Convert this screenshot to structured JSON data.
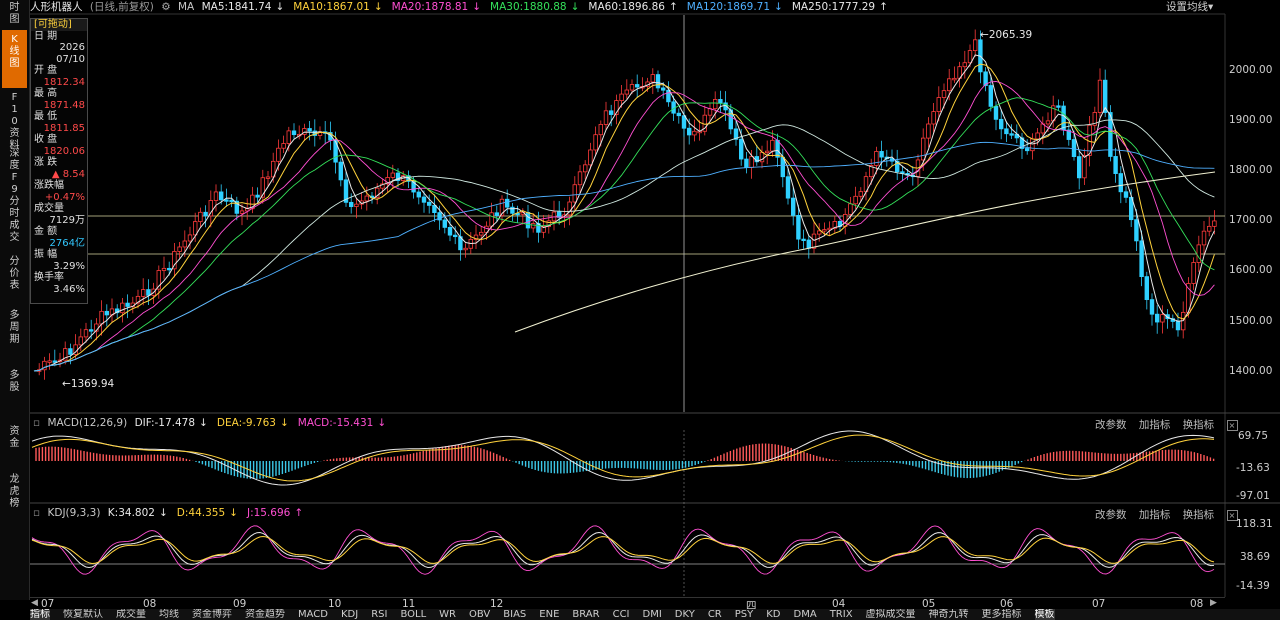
{
  "header": {
    "stock_name": "人形机器人",
    "adjust_note": "(日线,前复权)",
    "ma_label": "MA",
    "ma_items": [
      {
        "text": "MA5:1841.74",
        "arrow": "↓",
        "color": "#e8e8e8"
      },
      {
        "text": "MA10:1867.01",
        "arrow": "↓",
        "color": "#ffd23c"
      },
      {
        "text": "MA20:1878.81",
        "arrow": "↓",
        "color": "#ff4fd2"
      },
      {
        "text": "MA30:1880.88",
        "arrow": "↓",
        "color": "#34e05a"
      },
      {
        "text": "MA60:1896.86",
        "arrow": "↑",
        "color": "#e8e8e8"
      },
      {
        "text": "MA120:1869.71",
        "arrow": "↓",
        "color": "#4fb0ff"
      },
      {
        "text": "MA250:1777.29",
        "arrow": "↑",
        "color": "#e8e8e8"
      }
    ],
    "settings_label": "设置均线",
    "settings_arrow": "▾"
  },
  "left_nav": [
    {
      "label": "时图",
      "active": false
    },
    {
      "label": "K线图",
      "active": true
    },
    {
      "label": "F10资料",
      "active": false
    },
    {
      "label": "深度F9",
      "active": false
    },
    {
      "label": "分时成交",
      "active": false
    },
    {
      "label": "分价表",
      "active": false
    },
    {
      "label": "多周期",
      "active": false
    },
    {
      "label": "多股",
      "active": false
    },
    {
      "label": "资金",
      "active": false
    },
    {
      "label": "龙虎榜",
      "active": false
    }
  ],
  "info_panel": {
    "drag_label": "[可拖动]",
    "rows": [
      {
        "label": "日 期",
        "value": "2026",
        "color": "#e0e0e0"
      },
      {
        "label": "",
        "value": "07/10",
        "color": "#e0e0e0"
      },
      {
        "label": "开 盘",
        "value": "1812.34",
        "color": "#ff4a4a"
      },
      {
        "label": "最 高",
        "value": "1871.48",
        "color": "#ff4a4a"
      },
      {
        "label": "最 低",
        "value": "1811.85",
        "color": "#ff4a4a"
      },
      {
        "label": "收 盘",
        "value": "1820.06",
        "color": "#ff4a4a"
      },
      {
        "label": "涨 跌",
        "value": "▲ 8.54",
        "color": "#ff4a4a"
      },
      {
        "label": "涨跌幅",
        "value": "+0.47%",
        "color": "#ff4a4a"
      },
      {
        "label": "成交量",
        "value": "7129万",
        "color": "#e0e0e0"
      },
      {
        "label": "金 额",
        "value": "2764亿",
        "color": "#32c8ff"
      },
      {
        "label": "振 幅",
        "value": "3.29%",
        "color": "#e0e0e0"
      },
      {
        "label": "换手率",
        "value": "3.46%",
        "color": "#e0e0e0"
      }
    ]
  },
  "price_axis": [
    "2000.00",
    "1900.00",
    "1800.00",
    "1700.00",
    "1600.00",
    "1500.00",
    "1400.00"
  ],
  "price_annotations": {
    "high": "2065.39",
    "low": "1369.94"
  },
  "macd": {
    "title": "MACD(12,26,9)",
    "items": [
      {
        "text": "DIF:-17.478",
        "arrow": "↓",
        "color": "#e8e8e8"
      },
      {
        "text": "DEA:-9.763",
        "arrow": "↓",
        "color": "#ffd23c"
      },
      {
        "text": "MACD:-15.431",
        "arrow": "↓",
        "color": "#ff4fd2"
      }
    ],
    "axis": [
      "69.75",
      "-13.63",
      "-97.01"
    ]
  },
  "kdj": {
    "title": "KDJ(9,3,3)",
    "items": [
      {
        "text": "K:34.802",
        "arrow": "↓",
        "color": "#e8e8e8"
      },
      {
        "text": "D:44.355",
        "arrow": "↓",
        "color": "#ffd23c"
      },
      {
        "text": "J:15.696",
        "arrow": "↑",
        "color": "#ff4fd2"
      }
    ],
    "axis": [
      "118.31",
      "38.69",
      "-14.39"
    ]
  },
  "panel_buttons": {
    "params": "改参数",
    "add": "加指标",
    "swap": "换指标",
    "close": "×"
  },
  "x_axis": [
    "07",
    "08",
    "09",
    "10",
    "11",
    "12",
    "四",
    "04",
    "05",
    "06",
    "07",
    "08"
  ],
  "bottom_tabs": [
    {
      "label": "指标",
      "active": true
    },
    {
      "label": "恢复默认",
      "active": false
    },
    {
      "label": "成交量",
      "active": false
    },
    {
      "label": "均线",
      "active": false
    },
    {
      "label": "资金博弈",
      "active": false
    },
    {
      "label": "资金趋势",
      "active": false
    },
    {
      "label": "MACD",
      "active": false
    },
    {
      "label": "KDJ",
      "active": false
    },
    {
      "label": "RSI",
      "active": false
    },
    {
      "label": "BOLL",
      "active": false
    },
    {
      "label": "WR",
      "active": false
    },
    {
      "label": "OBV",
      "active": false
    },
    {
      "label": "BIAS",
      "active": false
    },
    {
      "label": "ENE",
      "active": false
    },
    {
      "label": "BRAR",
      "active": false
    },
    {
      "label": "CCI",
      "active": false
    },
    {
      "label": "DMI",
      "active": false
    },
    {
      "label": "DKY",
      "active": false
    },
    {
      "label": "CR",
      "active": false
    },
    {
      "label": "PSY",
      "active": false
    },
    {
      "label": "KD",
      "active": false
    },
    {
      "label": "DMA",
      "active": false
    },
    {
      "label": "TRIX",
      "active": false
    },
    {
      "label": "虚拟成交量",
      "active": false
    },
    {
      "label": "神奇九转",
      "active": false
    },
    {
      "label": "更多指标",
      "active": false
    },
    {
      "label": "模板",
      "active": true
    }
  ],
  "colors": {
    "up": "#ff3b3b",
    "down": "#2fd0ff",
    "accent": "#e06a00"
  }
}
